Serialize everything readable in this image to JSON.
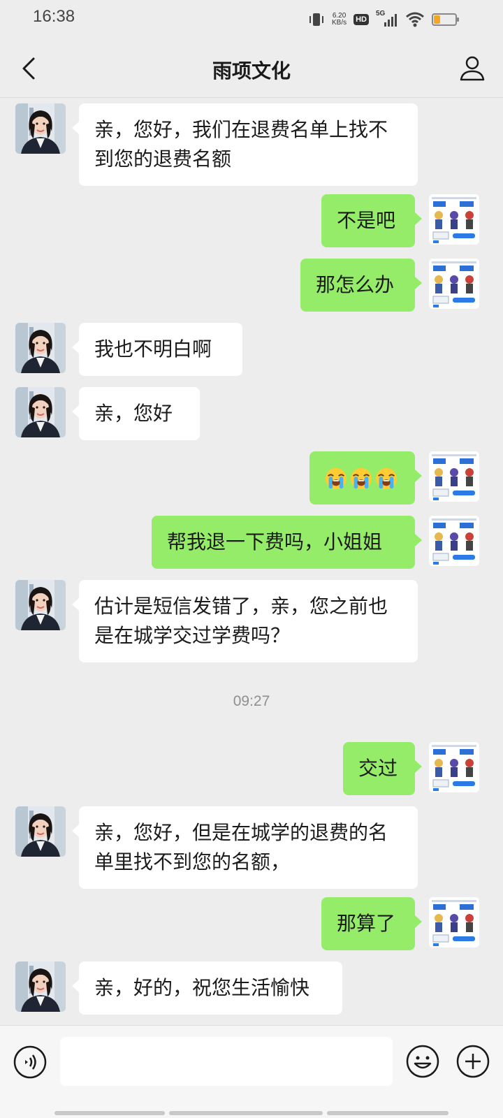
{
  "status_bar": {
    "time": "16:38",
    "net_speed_value": "6.20",
    "net_speed_unit": "KB/s",
    "hd_badge": "HD",
    "network": "5G",
    "battery_level": 0.3,
    "icons": [
      "vibrate-icon",
      "signal-icon",
      "wifi-icon",
      "battery-icon"
    ]
  },
  "header": {
    "title": "雨项文化",
    "back_icon": "chevron-left-icon",
    "profile_icon": "person-icon"
  },
  "colors": {
    "incoming_bubble": "#ffffff",
    "outgoing_bubble": "#95ec69",
    "background": "#ededed"
  },
  "messages": [
    {
      "from": "agent",
      "text": "亲，您好，我们在退费名单上找不到您的退费名额"
    },
    {
      "from": "me",
      "text": "不是吧"
    },
    {
      "from": "me",
      "text": "那怎么办"
    },
    {
      "from": "agent",
      "text": "我也不明白啊"
    },
    {
      "from": "agent",
      "text": "亲，您好"
    },
    {
      "from": "me",
      "emoji": [
        "loudly-crying-face",
        "loudly-crying-face",
        "loudly-crying-face"
      ]
    },
    {
      "from": "me",
      "text": "帮我退一下费吗，小姐姐"
    },
    {
      "from": "agent",
      "text": "估计是短信发错了，亲，您之前也是在城学交过学费吗？"
    },
    {
      "type": "timestamp",
      "text": "09:27"
    },
    {
      "from": "me",
      "text": "交过"
    },
    {
      "from": "agent",
      "text": "亲，您好，但是在城学的退费的名单里找不到您的名额，"
    },
    {
      "from": "me",
      "text": "那算了"
    },
    {
      "from": "agent",
      "text": "亲，好的，祝您生活愉快"
    }
  ],
  "input_bar": {
    "voice_icon": "voice-icon",
    "emoji_icon": "emoji-face-icon",
    "plus_icon": "plus-circle-icon",
    "input_value": ""
  }
}
